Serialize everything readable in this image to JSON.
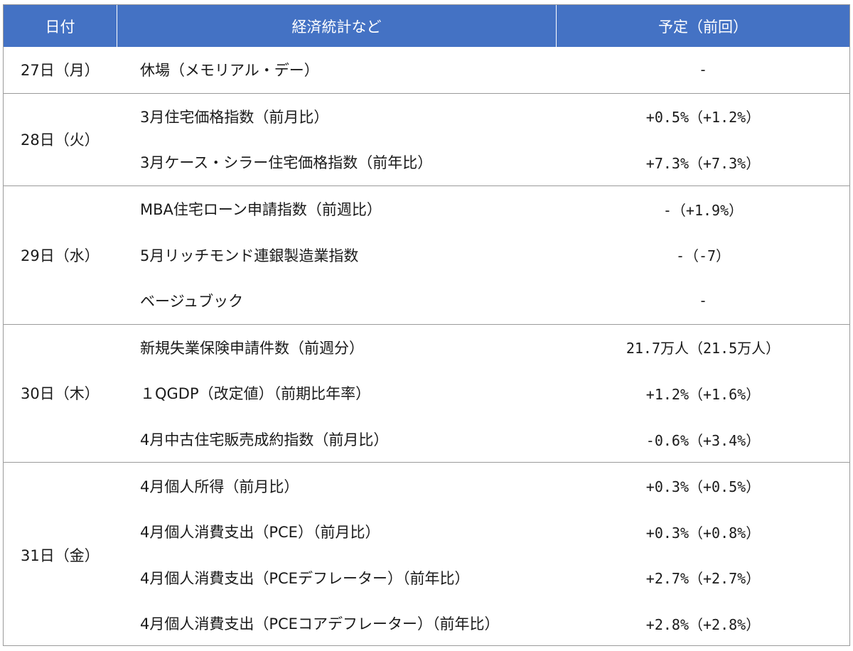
{
  "header": {
    "date": "日付",
    "stat": "経済統計など",
    "forecast": "予定（前回）"
  },
  "groups": [
    {
      "date": "27日（月）",
      "rows": [
        {
          "item": "休場（メモリアル・デー）",
          "value": "-"
        }
      ]
    },
    {
      "date": "28日（火）",
      "rows": [
        {
          "item": "3月住宅価格指数（前月比）",
          "value": "+0.5%（+1.2%）"
        },
        {
          "item": "3月ケース・シラー住宅価格指数（前年比）",
          "value": "+7.3%（+7.3%）"
        }
      ]
    },
    {
      "date": "29日（水）",
      "rows": [
        {
          "item": "MBA住宅ローン申請指数（前週比）",
          "value": "-（+1.9%）"
        },
        {
          "item": "5月リッチモンド連銀製造業指数",
          "value": "-（-7）"
        },
        {
          "item": "ベージュブック",
          "value": "-"
        }
      ]
    },
    {
      "date": "30日（木）",
      "rows": [
        {
          "item": "新規失業保険申請件数（前週分）",
          "value": "21.7万人（21.5万人）"
        },
        {
          "item": "１QGDP（改定値）（前期比年率）",
          "value": "+1.2%（+1.6%）"
        },
        {
          "item": "4月中古住宅販売成約指数（前月比）",
          "value": "-0.6%（+3.4%）"
        }
      ]
    },
    {
      "date": "31日（金）",
      "rows": [
        {
          "item": "4月個人所得（前月比）",
          "value": "+0.3%（+0.5%）"
        },
        {
          "item": "4月個人消費支出（PCE）（前月比）",
          "value": "+0.3%（+0.8%）"
        },
        {
          "item": "4月個人消費支出（PCEデフレーター）（前年比）",
          "value": "+2.7%（+2.7%）"
        },
        {
          "item": "4月個人消費支出（PCEコアデフレーター）（前年比）",
          "value": "+2.8%（+2.8%）"
        }
      ]
    }
  ],
  "colors": {
    "header_bg": "#4472c4",
    "header_text": "#ffffff",
    "border": "#9a9a9a"
  }
}
